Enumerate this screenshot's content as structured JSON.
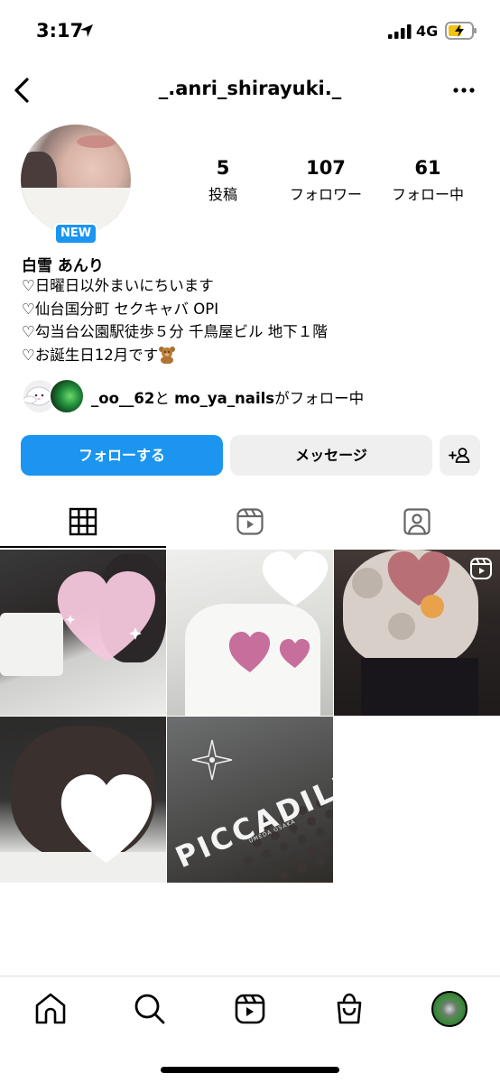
{
  "status_bar": {
    "time": "3:17",
    "network": "4G"
  },
  "header": {
    "username": "_.anri_shirayuki._"
  },
  "profile": {
    "new_badge": "NEW",
    "stats": [
      {
        "value": "5",
        "label": "投稿"
      },
      {
        "value": "107",
        "label": "フォロワー"
      },
      {
        "value": "61",
        "label": "フォロー中"
      }
    ],
    "name": "白雪 あんり",
    "bio_lines": [
      "♡日曜日以外まいにちいます",
      "♡仙台国分町 セクキャバ OPI",
      "♡勾当台公園駅徒歩５分 千鳥屋ビル 地下１階",
      "♡お誕生日12月です"
    ],
    "followed_by": {
      "user1": "_oo__62",
      "connector": "と",
      "user2": "mo_ya_nails",
      "suffix": "がフォロー中"
    }
  },
  "actions": {
    "follow_label": "フォローする",
    "message_label": "メッセージ",
    "accent_color": "#1b95f0"
  },
  "tabs": [
    {
      "icon": "grid-icon",
      "active": true
    },
    {
      "icon": "reels-icon",
      "active": false
    },
    {
      "icon": "tagged-icon",
      "active": false
    }
  ],
  "posts": {
    "count": 5,
    "cell5_text": "PICCADILLY",
    "cell5_subtext": "UMEDA OSAKA"
  },
  "bottom_nav": [
    "home-icon",
    "search-icon",
    "reels-icon",
    "shop-icon",
    "profile-avatar"
  ]
}
